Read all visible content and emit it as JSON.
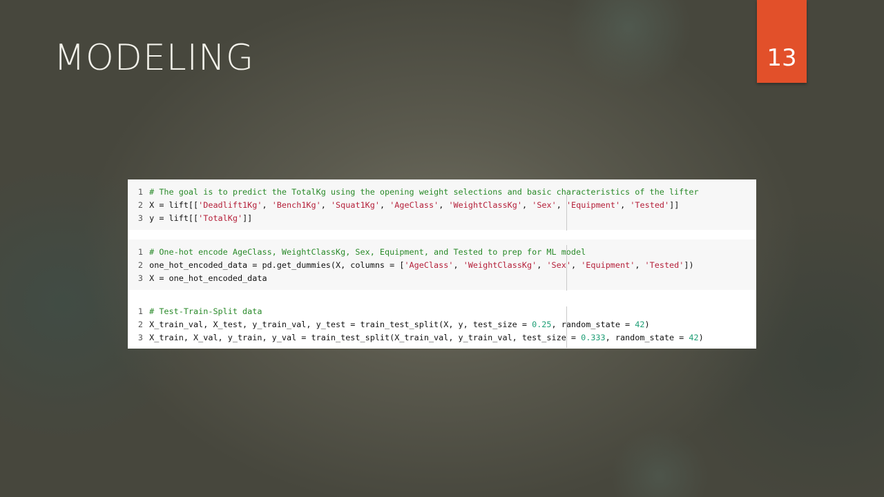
{
  "slide": {
    "title": "MODELING",
    "number": "13"
  },
  "colors": {
    "accent": "#e2502a",
    "comment": "#2a8a2a",
    "string": "#b5203a",
    "number": "#1d9e75"
  },
  "cells": [
    {
      "lines": [
        {
          "n": "1",
          "segments": [
            {
              "t": "cmt",
              "v": "# The goal is to predict the TotalKg using the opening weight selections and basic characteristics of the lifter"
            }
          ]
        },
        {
          "n": "2",
          "segments": [
            {
              "t": "plain",
              "v": "X = lift[["
            },
            {
              "t": "str",
              "v": "'Deadlift1Kg'"
            },
            {
              "t": "plain",
              "v": ", "
            },
            {
              "t": "str",
              "v": "'Bench1Kg'"
            },
            {
              "t": "plain",
              "v": ", "
            },
            {
              "t": "str",
              "v": "'Squat1Kg'"
            },
            {
              "t": "plain",
              "v": ", "
            },
            {
              "t": "str",
              "v": "'AgeClass'"
            },
            {
              "t": "plain",
              "v": ", "
            },
            {
              "t": "str",
              "v": "'WeightClassKg'"
            },
            {
              "t": "plain",
              "v": ", "
            },
            {
              "t": "str",
              "v": "'Sex'"
            },
            {
              "t": "plain",
              "v": ", "
            },
            {
              "t": "str",
              "v": "'Equipment'"
            },
            {
              "t": "plain",
              "v": ", "
            },
            {
              "t": "str",
              "v": "'Tested'"
            },
            {
              "t": "plain",
              "v": "]]"
            }
          ]
        },
        {
          "n": "3",
          "segments": [
            {
              "t": "plain",
              "v": "y = lift[["
            },
            {
              "t": "str",
              "v": "'TotalKg'"
            },
            {
              "t": "plain",
              "v": "]]"
            }
          ]
        }
      ]
    },
    {
      "lines": [
        {
          "n": "1",
          "segments": [
            {
              "t": "cmt",
              "v": "# One-hot encode AgeClass, WeightClassKg, Sex, Equipment, and Tested to prep for ML model"
            }
          ]
        },
        {
          "n": "2",
          "segments": [
            {
              "t": "plain",
              "v": "one_hot_encoded_data = pd.get_dummies(X, columns = ["
            },
            {
              "t": "str",
              "v": "'AgeClass'"
            },
            {
              "t": "plain",
              "v": ", "
            },
            {
              "t": "str",
              "v": "'WeightClassKg'"
            },
            {
              "t": "plain",
              "v": ", "
            },
            {
              "t": "str",
              "v": "'Sex'"
            },
            {
              "t": "plain",
              "v": ", "
            },
            {
              "t": "str",
              "v": "'Equipment'"
            },
            {
              "t": "plain",
              "v": ", "
            },
            {
              "t": "str",
              "v": "'Tested'"
            },
            {
              "t": "plain",
              "v": "])"
            }
          ]
        },
        {
          "n": "3",
          "segments": [
            {
              "t": "plain",
              "v": "X = one_hot_encoded_data"
            }
          ]
        }
      ]
    },
    {
      "lines": [
        {
          "n": "1",
          "segments": [
            {
              "t": "cmt",
              "v": "# Test-Train-Split data"
            }
          ]
        },
        {
          "n": "2",
          "segments": [
            {
              "t": "plain",
              "v": "X_train_val, X_test, y_train_val, y_test = train_test_split(X, y, test_size = "
            },
            {
              "t": "num",
              "v": "0.25"
            },
            {
              "t": "plain",
              "v": ", random_state = "
            },
            {
              "t": "num",
              "v": "42"
            },
            {
              "t": "plain",
              "v": ")"
            }
          ]
        },
        {
          "n": "3",
          "segments": [
            {
              "t": "plain",
              "v": "X_train, X_val, y_train, y_val = train_test_split(X_train_val, y_train_val, test_size = "
            },
            {
              "t": "num",
              "v": "0.333"
            },
            {
              "t": "plain",
              "v": ", random_state = "
            },
            {
              "t": "num",
              "v": "42"
            },
            {
              "t": "plain",
              "v": ")"
            }
          ]
        }
      ]
    }
  ]
}
